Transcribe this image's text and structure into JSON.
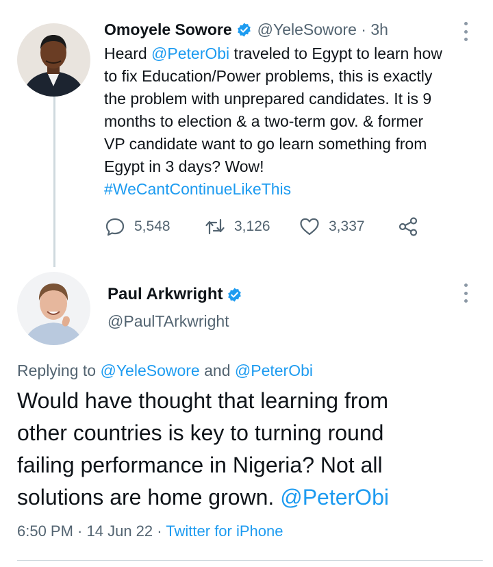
{
  "tweet1": {
    "author_name": "Omoyele Sowore",
    "handle": "@YeleSowore",
    "separator": " · ",
    "time": "3h",
    "text_lines": [
      {
        "pre": "Heard ",
        "mention": "@PeterObi",
        "post": " traveled to Egypt to learn how"
      },
      {
        "text": "to fix Education/Power problems, this is exactly"
      },
      {
        "text": "the problem with unprepared candidates. It is 9"
      },
      {
        "text": "months to election & a two-term gov. & former"
      },
      {
        "text": "VP candidate want to go learn something from"
      },
      {
        "text": "Egypt in 3 days? Wow!"
      }
    ],
    "hashtag": "#WeCantContinueLikeThis",
    "reply_count": "5,548",
    "retweet_count": "3,126",
    "like_count": "3,337"
  },
  "tweet2": {
    "author_name": "Paul Arkwright",
    "handle": "@PaulTArkwright",
    "replying_prefix": "Replying to ",
    "replying_to_1": "@YeleSowore",
    "replying_and": " and ",
    "replying_to_2": "@PeterObi",
    "text_lines": [
      "Would have thought that learning from",
      "other countries is key to turning round",
      "failing performance in Nigeria? Not all"
    ],
    "last_line": "solutions are home grown. ",
    "last_mention": "@PeterObi",
    "time": "6:50 PM",
    "date_sep": " · ",
    "date": "14 Jun 22",
    "source_sep": " · ",
    "source": "Twitter for iPhone"
  },
  "icons": {
    "reply": "speech-bubble-icon",
    "retweet": "retweet-arrows-icon",
    "like": "heart-outline-icon",
    "share": "share-nodes-icon",
    "verified": "verified-badge-icon",
    "more": "vertical-ellipsis-icon"
  },
  "colors": {
    "link": "#1d9bf0",
    "muted": "#536471",
    "text": "#0f1419",
    "verified": "#1d9bf0"
  }
}
